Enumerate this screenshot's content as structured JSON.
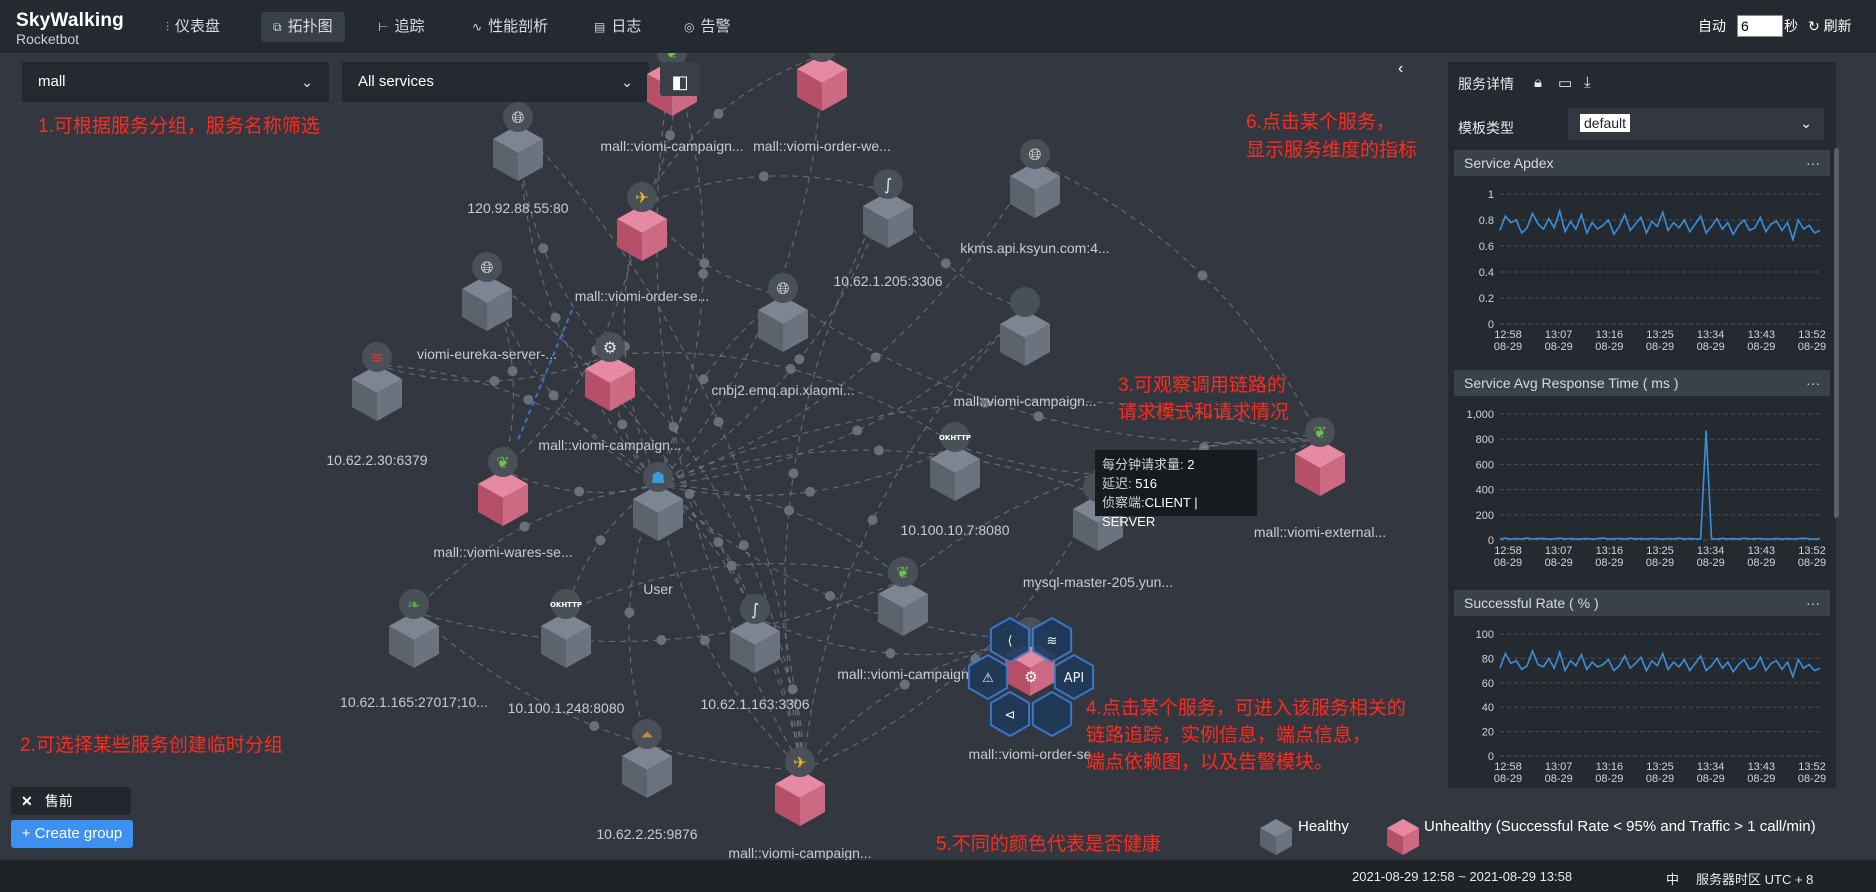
{
  "app": {
    "logo_line1": "SkyWalking",
    "logo_line2": "Rocketbot"
  },
  "nav": [
    {
      "label": "仪表盘",
      "icon": "dashboard-icon",
      "glyph": "⫶"
    },
    {
      "label": "拓扑图",
      "icon": "topology-icon",
      "glyph": "⧉"
    },
    {
      "label": "追踪",
      "icon": "trace-icon",
      "glyph": "⊢"
    },
    {
      "label": "性能剖析",
      "icon": "profile-icon",
      "glyph": "∿"
    },
    {
      "label": "日志",
      "icon": "log-icon",
      "glyph": "▤"
    },
    {
      "label": "告警",
      "icon": "alarm-icon",
      "glyph": "◎"
    }
  ],
  "auto_refresh": {
    "auto_label": "自动",
    "interval_value": "6",
    "unit_label": "秒",
    "refresh_label": "刷新"
  },
  "filters": {
    "group_value": "mall",
    "service_value": "All services"
  },
  "annotations": {
    "n1": "1.可根据服务分组，服务名称筛选",
    "n2": "2.可选择某些服务创建临时分组",
    "n3a": "3.可观察调用链路的",
    "n3b": "请求模式和请求情况",
    "n4a": "4.点击某个服务，可进入该服务相关的",
    "n4b": "链路追踪，实例信息，端点信息，",
    "n4c": "端点依赖图，以及告警模块。",
    "n5": "5.不同的颜色代表是否健康",
    "n6a": "6.点击某个服务，",
    "n6b": "显示服务维度的指标"
  },
  "nodes": [
    {
      "label": "mall::viomi-campaign...",
      "status": "unhealthy",
      "icon": "spring-leaf-icon"
    },
    {
      "label": "mall::viomi-order-we...",
      "status": "unhealthy",
      "icon": "dubbo-icon"
    },
    {
      "label": "120.92.88.55:80",
      "status": "healthy",
      "icon": "globe-icon"
    },
    {
      "label": "mall::viomi-order-se...",
      "status": "unhealthy",
      "icon": "dubbo-icon"
    },
    {
      "label": "10.62.1.205:3306",
      "status": "healthy",
      "icon": "mysql-icon"
    },
    {
      "label": "kkms.api.ksyun.com:4...",
      "status": "healthy",
      "icon": "globe-icon"
    },
    {
      "label": "viomi-eureka-server-...",
      "status": "healthy",
      "icon": "globe-icon"
    },
    {
      "label": "cnbj2.emq.api.xiaomi...",
      "status": "healthy",
      "icon": "globe-icon"
    },
    {
      "label": "mall::viomi-campaign...",
      "status": "healthy",
      "icon": "blank-icon"
    },
    {
      "label": "10.62.2.30:6379",
      "status": "healthy",
      "icon": "redis-icon"
    },
    {
      "label": "mall::viomi-campaign...",
      "status": "unhealthy",
      "icon": "kafka-icon"
    },
    {
      "label": "mall::viomi-wares-se...",
      "status": "unhealthy",
      "icon": "spring-leaf-icon"
    },
    {
      "label": "User",
      "status": "healthy",
      "icon": "users-icon"
    },
    {
      "label": "10.100.10.7:8080",
      "status": "healthy",
      "icon": "okhttp-icon"
    },
    {
      "label": "mysql-master-205.yun...",
      "status": "healthy",
      "icon": "blank-icon"
    },
    {
      "label": "mall::viomi-external...",
      "status": "unhealthy",
      "icon": "spring-leaf-icon"
    },
    {
      "label": "10.62.1.165:27017;10...",
      "status": "healthy",
      "icon": "mongodb-icon"
    },
    {
      "label": "10.100.1.248:8080",
      "status": "healthy",
      "icon": "okhttp-icon"
    },
    {
      "label": "10.62.1.163:3306",
      "status": "healthy",
      "icon": "mysql-icon"
    },
    {
      "label": "mall::viomi-campaign",
      "status": "healthy",
      "icon": "spring-leaf-icon"
    },
    {
      "label": "mall::viomi-order-se",
      "status": "unhealthy",
      "icon": "blank-icon"
    },
    {
      "label": "10.62.2.25:9876",
      "status": "healthy",
      "icon": "rocketmq-icon"
    },
    {
      "label": "mall::viomi-campaign...",
      "status": "unhealthy",
      "icon": "dubbo-icon"
    }
  ],
  "okhttp_text": "OKHTTP",
  "tooltip": {
    "k1": "每分钟请求量: ",
    "v1": "2",
    "k2": "延迟: ",
    "v2": "516",
    "k3": "侦察端:",
    "v3": "CLIENT | SERVER"
  },
  "radial_menu": {
    "api_label": "API"
  },
  "panel": {
    "title": "服务详情",
    "template_label": "模板类型",
    "template_value": "default",
    "card_menu": "···"
  },
  "tags": {
    "tag1": "售前",
    "create_group": "+ Create group"
  },
  "legend": {
    "healthy": "Healthy",
    "unhealthy": "Unhealthy (Successful Rate < 95% and Traffic > 1 call/min)"
  },
  "footer": {
    "time_range": "2021-08-29 12:58 ~ 2021-08-29 13:58",
    "lang": "中",
    "timezone": "服务器时区 UTC + 8"
  },
  "chart_data": [
    {
      "type": "line",
      "title": "Service Apdex",
      "ylim": [
        0,
        1
      ],
      "y_ticks": [
        "0",
        "0.2",
        "0.4",
        "0.6",
        "0.8",
        "1"
      ],
      "x_ticks": [
        "12:58",
        "13:07",
        "13:16",
        "13:25",
        "13:34",
        "13:43",
        "13:52"
      ],
      "x_tick_dates": [
        "08-29",
        "08-29",
        "08-29",
        "08-29",
        "08-29",
        "08-29",
        "08-29"
      ],
      "color": "#3a8fdc",
      "values": [
        0.72,
        0.83,
        0.78,
        0.8,
        0.7,
        0.74,
        0.85,
        0.77,
        0.73,
        0.81,
        0.74,
        0.87,
        0.71,
        0.79,
        0.73,
        0.84,
        0.7,
        0.78,
        0.73,
        0.76,
        0.8,
        0.69,
        0.75,
        0.84,
        0.72,
        0.77,
        0.82,
        0.7,
        0.79,
        0.75,
        0.86,
        0.72,
        0.78,
        0.74,
        0.8,
        0.71,
        0.77,
        0.83,
        0.7,
        0.75,
        0.81,
        0.73,
        0.78,
        0.69,
        0.76,
        0.8,
        0.72,
        0.74,
        0.82,
        0.71,
        0.77,
        0.79,
        0.72,
        0.78,
        0.65,
        0.8,
        0.73,
        0.76,
        0.7,
        0.72
      ]
    },
    {
      "type": "line",
      "title": "Service Avg Response Time ( ms )",
      "ylim": [
        0,
        1000
      ],
      "y_ticks": [
        "0",
        "200",
        "400",
        "600",
        "800",
        "1,000"
      ],
      "x_ticks": [
        "12:58",
        "13:07",
        "13:16",
        "13:25",
        "13:34",
        "13:43",
        "13:52"
      ],
      "x_tick_dates": [
        "08-29",
        "08-29",
        "08-29",
        "08-29",
        "08-29",
        "08-29",
        "08-29"
      ],
      "color": "#3a8fdc",
      "values": [
        8,
        14,
        6,
        12,
        9,
        15,
        7,
        11,
        13,
        6,
        10,
        14,
        8,
        12,
        7,
        9,
        13,
        6,
        11,
        15,
        8,
        10,
        12,
        7,
        14,
        9,
        11,
        8,
        13,
        10,
        6,
        12,
        9,
        14,
        7,
        11,
        8,
        10,
        870,
        12,
        7,
        13,
        9,
        11,
        6,
        14,
        8,
        10,
        12,
        7,
        9,
        13,
        6,
        11,
        8,
        10,
        14,
        9,
        7,
        12
      ]
    },
    {
      "type": "line",
      "title": "Successful Rate ( % )",
      "ylim": [
        0,
        100
      ],
      "y_ticks": [
        "0",
        "20",
        "40",
        "60",
        "80",
        "100"
      ],
      "x_ticks": [
        "12:58",
        "13:07",
        "13:16",
        "13:25",
        "13:34",
        "13:43",
        "13:52"
      ],
      "x_tick_dates": [
        "08-29",
        "08-29",
        "08-29",
        "08-29",
        "08-29",
        "08-29",
        "08-29"
      ],
      "color": "#3a8fdc",
      "values": [
        72,
        84,
        76,
        78,
        71,
        74,
        86,
        75,
        73,
        80,
        72,
        85,
        70,
        78,
        74,
        83,
        71,
        77,
        73,
        75,
        79,
        70,
        74,
        82,
        72,
        76,
        81,
        70,
        78,
        74,
        84,
        71,
        77,
        73,
        79,
        70,
        76,
        82,
        70,
        74,
        80,
        72,
        77,
        69,
        75,
        79,
        71,
        73,
        81,
        70,
        76,
        78,
        71,
        77,
        65,
        79,
        72,
        75,
        70,
        72
      ]
    }
  ]
}
